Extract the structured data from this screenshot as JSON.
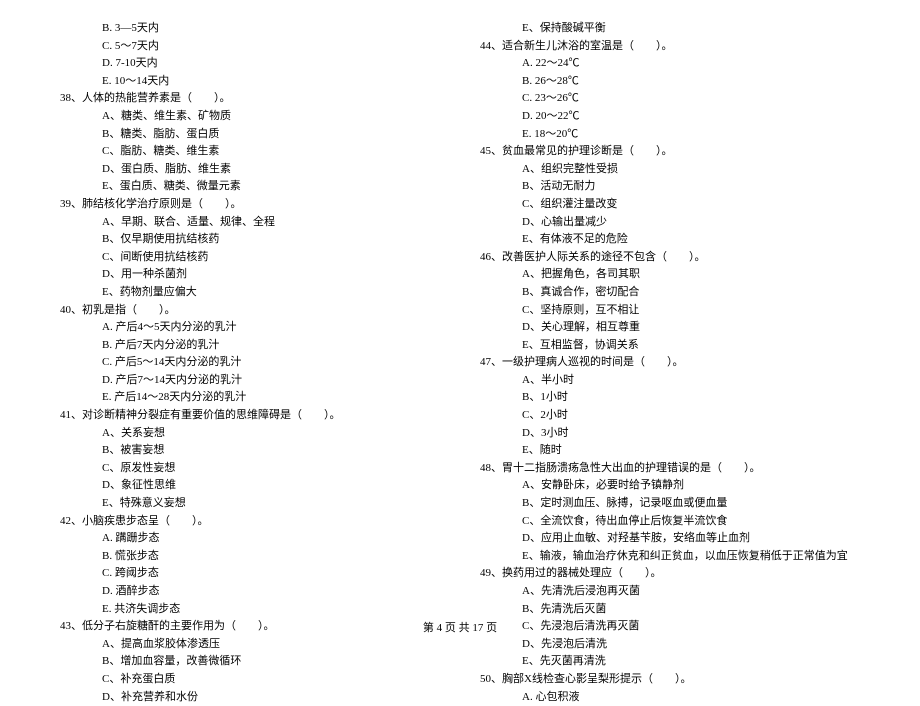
{
  "leftColumn": [
    {
      "cls": "option",
      "text": "B. 3―5天内"
    },
    {
      "cls": "option",
      "text": "C. 5～7天内"
    },
    {
      "cls": "option",
      "text": "D. 7‐10天内"
    },
    {
      "cls": "option",
      "text": "E. 10～14天内"
    },
    {
      "cls": "question",
      "text": "38、人体的热能营养素是（　　）。"
    },
    {
      "cls": "option",
      "text": "A、糖类、维生素、矿物质"
    },
    {
      "cls": "option",
      "text": "B、糖类、脂肪、蛋白质"
    },
    {
      "cls": "option",
      "text": "C、脂肪、糖类、维生素"
    },
    {
      "cls": "option",
      "text": "D、蛋白质、脂肪、维生素"
    },
    {
      "cls": "option",
      "text": "E、蛋白质、糖类、微量元素"
    },
    {
      "cls": "question",
      "text": "39、肺结核化学治疗原则是（　　）。"
    },
    {
      "cls": "option",
      "text": "A、早期、联合、适量、规律、全程"
    },
    {
      "cls": "option",
      "text": "B、仅早期使用抗结核药"
    },
    {
      "cls": "option",
      "text": "C、间断使用抗结核药"
    },
    {
      "cls": "option",
      "text": "D、用一种杀菌剂"
    },
    {
      "cls": "option",
      "text": "E、药物剂量应偏大"
    },
    {
      "cls": "question",
      "text": "40、初乳是指（　　）。"
    },
    {
      "cls": "option",
      "text": "A. 产后4～5天内分泌的乳汁"
    },
    {
      "cls": "option",
      "text": "B. 产后7天内分泌的乳汁"
    },
    {
      "cls": "option",
      "text": "C. 产后5～14天内分泌的乳汁"
    },
    {
      "cls": "option",
      "text": "D. 产后7～14天内分泌的乳汁"
    },
    {
      "cls": "option",
      "text": "E. 产后14～28天内分泌的乳汁"
    },
    {
      "cls": "question",
      "text": "41、对诊断精神分裂症有重要价值的思维障碍是（　　）。"
    },
    {
      "cls": "option",
      "text": "A、关系妄想"
    },
    {
      "cls": "option",
      "text": "B、被害妄想"
    },
    {
      "cls": "option",
      "text": "C、原发性妄想"
    },
    {
      "cls": "option",
      "text": "D、象征性思维"
    },
    {
      "cls": "option",
      "text": "E、特殊意义妄想"
    },
    {
      "cls": "question",
      "text": "42、小脑疾患步态呈（　　）。"
    },
    {
      "cls": "option",
      "text": "A. 蹒跚步态"
    },
    {
      "cls": "option",
      "text": "B. 慌张步态"
    },
    {
      "cls": "option",
      "text": "C. 跨阈步态"
    },
    {
      "cls": "option",
      "text": "D. 酒醉步态"
    },
    {
      "cls": "option",
      "text": "E. 共济失调步态"
    },
    {
      "cls": "question",
      "text": "43、低分子右旋糖酐的主要作用为（　　）。"
    },
    {
      "cls": "option",
      "text": "A、提高血浆胶体渗透压"
    },
    {
      "cls": "option",
      "text": "B、增加血容量，改善微循环"
    },
    {
      "cls": "option",
      "text": "C、补充蛋白质"
    },
    {
      "cls": "option",
      "text": "D、补充营养和水份"
    }
  ],
  "rightColumn": [
    {
      "cls": "option",
      "text": "E、保持酸碱平衡"
    },
    {
      "cls": "question",
      "text": "44、适合新生儿沐浴的室温是（　　）。"
    },
    {
      "cls": "option",
      "text": "A. 22～24℃"
    },
    {
      "cls": "option",
      "text": "B. 26～28℃"
    },
    {
      "cls": "option",
      "text": "C. 23～26℃"
    },
    {
      "cls": "option",
      "text": "D. 20～22℃"
    },
    {
      "cls": "option",
      "text": "E. 18～20℃"
    },
    {
      "cls": "question",
      "text": "45、贫血最常见的护理诊断是（　　）。"
    },
    {
      "cls": "option",
      "text": "A、组织完整性受损"
    },
    {
      "cls": "option",
      "text": "B、活动无耐力"
    },
    {
      "cls": "option",
      "text": "C、组织灌注量改变"
    },
    {
      "cls": "option",
      "text": "D、心输出量减少"
    },
    {
      "cls": "option",
      "text": "E、有体液不足的危险"
    },
    {
      "cls": "question",
      "text": "46、改善医护人际关系的途径不包含（　　）。"
    },
    {
      "cls": "option",
      "text": "A、把握角色，各司其职"
    },
    {
      "cls": "option",
      "text": "B、真诚合作，密切配合"
    },
    {
      "cls": "option",
      "text": "C、坚持原则，互不相让"
    },
    {
      "cls": "option",
      "text": "D、关心理解，相互尊重"
    },
    {
      "cls": "option",
      "text": "E、互相监督，协调关系"
    },
    {
      "cls": "question",
      "text": "47、一级护理病人巡视的时间是（　　）。"
    },
    {
      "cls": "option",
      "text": "A、半小时"
    },
    {
      "cls": "option",
      "text": "B、1小时"
    },
    {
      "cls": "option",
      "text": "C、2小时"
    },
    {
      "cls": "option",
      "text": "D、3小时"
    },
    {
      "cls": "option",
      "text": "E、随时"
    },
    {
      "cls": "question",
      "text": "48、胃十二指肠溃疡急性大出血的护理错误的是（　　）。"
    },
    {
      "cls": "option",
      "text": "A、安静卧床，必要时给予镇静剂"
    },
    {
      "cls": "option",
      "text": "B、定时测血压、脉搏，记录呕血或便血量"
    },
    {
      "cls": "option",
      "text": "C、全流饮食，待出血停止后恢复半流饮食"
    },
    {
      "cls": "option",
      "text": "D、应用止血敏、对羟基苄胺，安络血等止血剂"
    },
    {
      "cls": "option",
      "text": "E、输液，输血治疗休克和纠正贫血，以血压恢复稍低于正常值为宜"
    },
    {
      "cls": "question",
      "text": "49、换药用过的器械处理应（　　）。"
    },
    {
      "cls": "option",
      "text": "A、先清洗后浸泡再灭菌"
    },
    {
      "cls": "option",
      "text": "B、先清洗后灭菌"
    },
    {
      "cls": "option",
      "text": "C、先浸泡后清洗再灭菌"
    },
    {
      "cls": "option",
      "text": "D、先浸泡后清洗"
    },
    {
      "cls": "option",
      "text": "E、先灭菌再清洗"
    },
    {
      "cls": "question",
      "text": "50、胸部X线检查心影呈梨形提示（　　）。"
    },
    {
      "cls": "option",
      "text": "A. 心包积液"
    }
  ],
  "footer": "第 4 页 共 17 页"
}
